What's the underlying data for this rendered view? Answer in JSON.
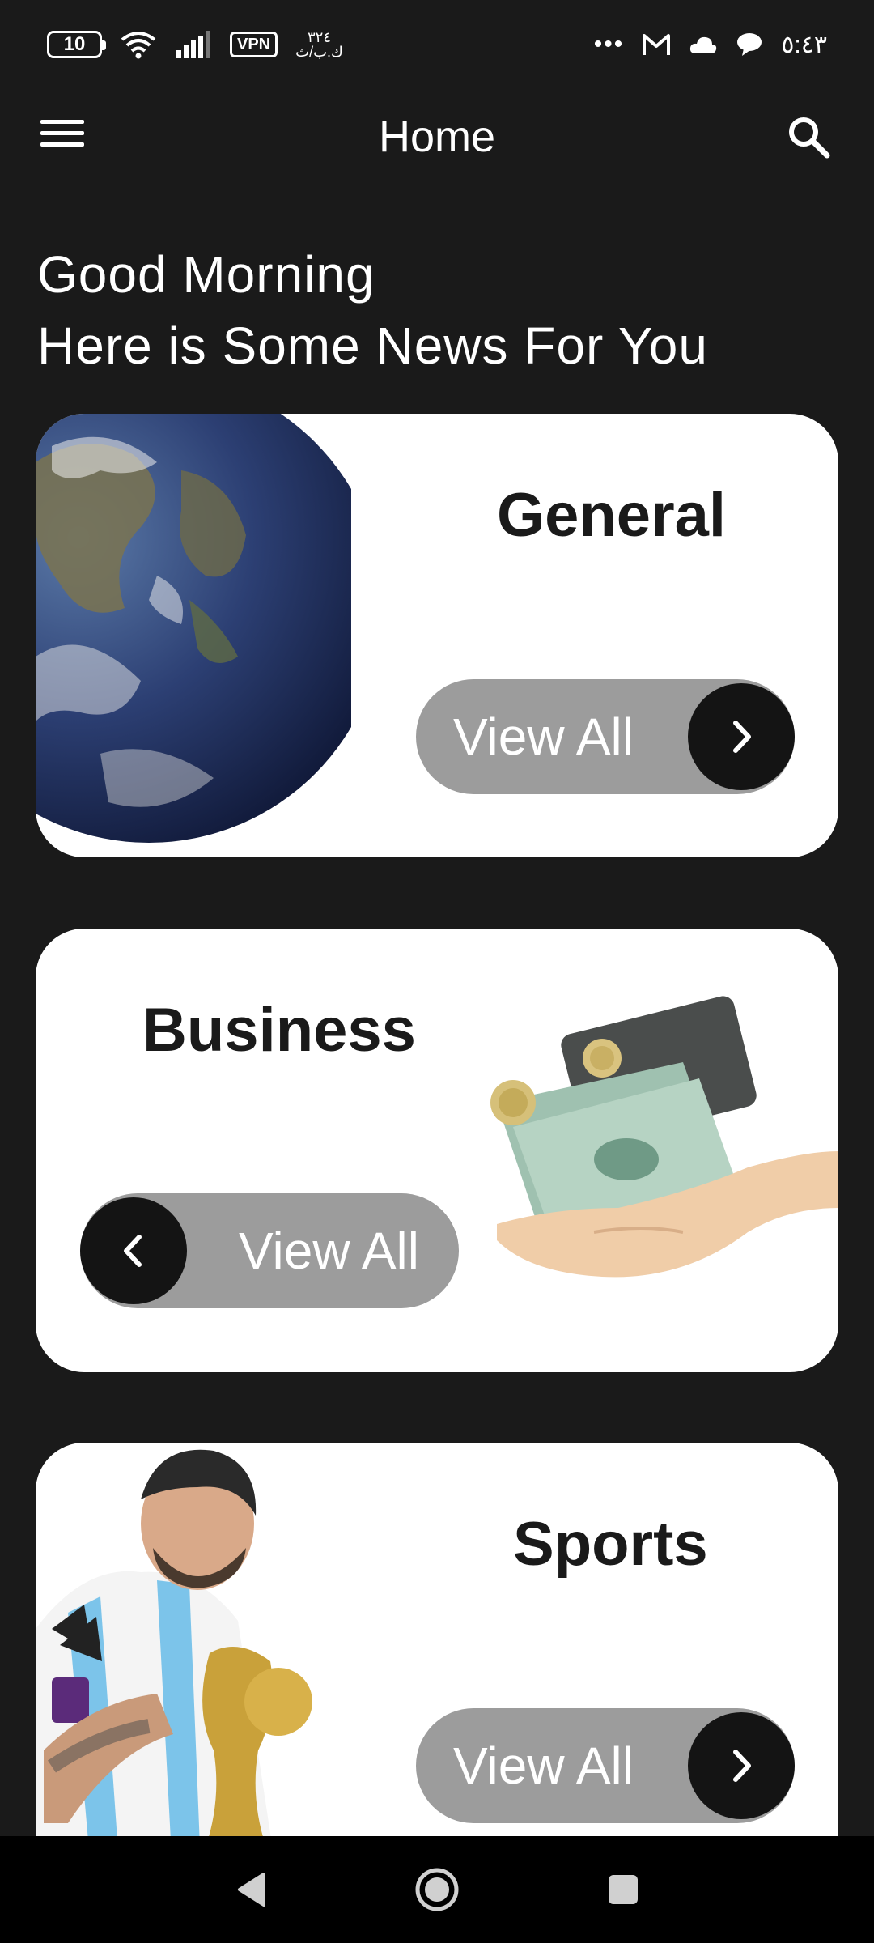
{
  "status_bar": {
    "battery": "10",
    "vpn": "VPN",
    "data_rate": "٣٢٤",
    "data_unit": "ك.ب/ث",
    "time": "٥:٤٣",
    "more": "•••"
  },
  "app_bar": {
    "title": "Home"
  },
  "greeting": {
    "line1": "Good Morning",
    "line2": "Here is Some News For You"
  },
  "categories": [
    {
      "title": "General",
      "button_label": "View All"
    },
    {
      "title": "Business",
      "button_label": "View All"
    },
    {
      "title": "Sports",
      "button_label": "View All"
    }
  ],
  "colors": {
    "background": "#1a1a1a",
    "card": "#ffffff",
    "button": "#9c9c9c",
    "button_circle": "#141414"
  }
}
